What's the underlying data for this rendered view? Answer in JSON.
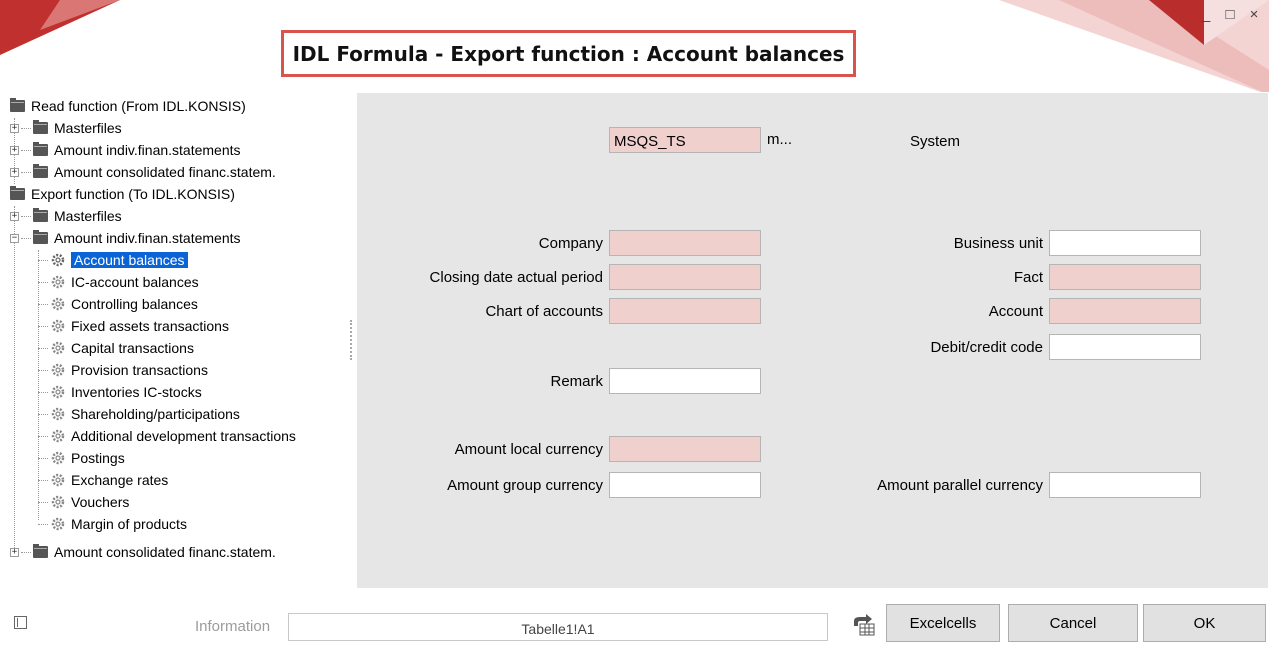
{
  "window": {
    "title": "IDL Formula - Export function : Account balances",
    "controls": {
      "minimize": "_",
      "maximize": "□",
      "close": "×"
    }
  },
  "tree": {
    "read_root": "Read function (From IDL.KONSIS)",
    "read_children": [
      "Masterfiles",
      "Amount indiv.finan.statements",
      "Amount consolidated financ.statem."
    ],
    "export_root": "Export function (To IDL.KONSIS)",
    "export_masterfiles": "Masterfiles",
    "export_indiv": "Amount indiv.finan.statements",
    "export_indiv_items": [
      "Account balances",
      "IC-account balances",
      "Controlling balances",
      "Fixed assets transactions",
      "Capital transactions",
      "Provision transactions",
      "Inventories IC-stocks",
      "Shareholding/participations",
      "Additional development transactions",
      "Postings",
      "Exchange rates",
      "Vouchers",
      "Margin of products"
    ],
    "export_consolidated": "Amount consolidated financ.statem."
  },
  "form": {
    "system": {
      "label": "System",
      "value": "MSQS_TS",
      "suffix": "m..."
    },
    "company": {
      "label": "Company",
      "value": ""
    },
    "closing_date": {
      "label": "Closing date actual period",
      "value": ""
    },
    "chart_of_accounts": {
      "label": "Chart of accounts",
      "value": ""
    },
    "remark": {
      "label": "Remark",
      "value": ""
    },
    "amount_local": {
      "label": "Amount local currency",
      "value": ""
    },
    "amount_group": {
      "label": "Amount group currency",
      "value": ""
    },
    "business_unit": {
      "label": "Business unit",
      "value": ""
    },
    "fact": {
      "label": "Fact",
      "value": ""
    },
    "account": {
      "label": "Account",
      "value": ""
    },
    "debit_credit": {
      "label": "Debit/credit code",
      "value": ""
    },
    "amount_parallel": {
      "label": "Amount parallel currency",
      "value": ""
    }
  },
  "footer": {
    "info_label": "Information",
    "info_value": "Tabelle1!A1",
    "excelcells": "Excelcells",
    "cancel": "Cancel",
    "ok": "OK"
  },
  "colors": {
    "required_field": "#f0d0cd",
    "selection": "#0b64d6",
    "title_border": "#d9534f",
    "panel": "#e6e6e6"
  },
  "icons": [
    "folder-icon",
    "gear-icon",
    "expand-icon",
    "collapse-icon",
    "excel-icon",
    "panel-toggle-icon"
  ]
}
